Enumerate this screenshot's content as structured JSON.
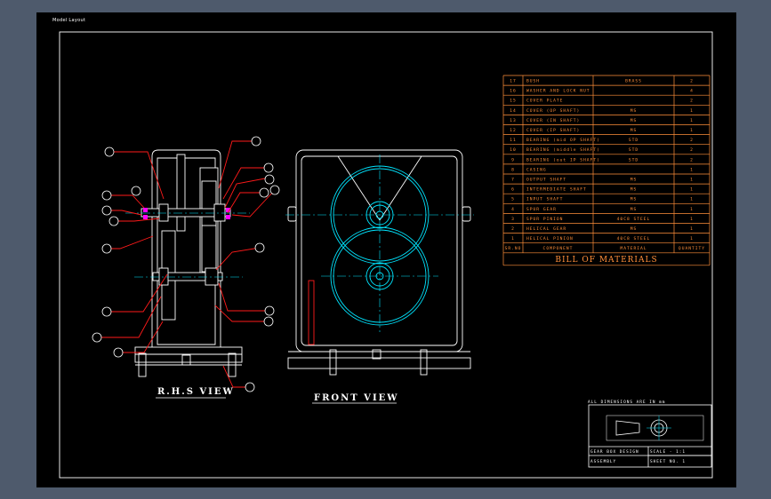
{
  "tab_label": "Model  Layout",
  "views": {
    "side_title": "R.H.S VIEW",
    "front_title": "FRONT VIEW"
  },
  "bom": {
    "title": "BILL OF MATERIALS",
    "header": {
      "no": "SR.NO",
      "name": "COMPONENT",
      "material": "MATERIAL",
      "qty": "QUANTITY"
    },
    "rows": [
      {
        "no": "17",
        "name": "BUSH",
        "material": "BRASS",
        "qty": "2"
      },
      {
        "no": "16",
        "name": "WASHER AND LOCK NUT",
        "material": "",
        "qty": "4"
      },
      {
        "no": "15",
        "name": "COVER PLATE",
        "material": "",
        "qty": "2"
      },
      {
        "no": "14",
        "name": "COVER (OP SHAFT)",
        "material": "MS",
        "qty": "1"
      },
      {
        "no": "13",
        "name": "COVER (IN SHAFT)",
        "material": "MS",
        "qty": "1"
      },
      {
        "no": "12",
        "name": "COVER (IP SHAFT)",
        "material": "MS",
        "qty": "1"
      },
      {
        "no": "11",
        "name": "BEARING (mid OP SHAFT)",
        "material": "STD",
        "qty": "2"
      },
      {
        "no": "10",
        "name": "BEARING (middle SHAFT)",
        "material": "STD",
        "qty": "2"
      },
      {
        "no": "9",
        "name": "BEARING (out IP SHAFT)",
        "material": "STD",
        "qty": "2"
      },
      {
        "no": "8",
        "name": "CASING",
        "material": "",
        "qty": "1"
      },
      {
        "no": "7",
        "name": "OUTPUT SHAFT",
        "material": "MS",
        "qty": "1"
      },
      {
        "no": "6",
        "name": "INTERMEDIATE SHAFT",
        "material": "MS",
        "qty": "1"
      },
      {
        "no": "5",
        "name": "INPUT SHAFT",
        "material": "MS",
        "qty": "1"
      },
      {
        "no": "4",
        "name": "SPUR GEAR",
        "material": "MS",
        "qty": "1"
      },
      {
        "no": "3",
        "name": "SPUR PINION",
        "material": "40C8 STEEL",
        "qty": "1"
      },
      {
        "no": "2",
        "name": "HELICAL GEAR",
        "material": "MS",
        "qty": "1"
      },
      {
        "no": "1",
        "name": "HELICAL PINION",
        "material": "40C8 STEEL",
        "qty": "1"
      }
    ]
  },
  "title_block": {
    "note": "ALL DIMENSIONS ARE IN mm",
    "row1_left": "GEAR BOX DESIGN",
    "row1_right": "SCALE - 1:1",
    "row2_left": "ASSEMBLY",
    "row2_right": "SHEET NO. 1"
  },
  "colors": {
    "background": "#4e5a6c",
    "sheet": "#000000",
    "border": "#ffffff",
    "bom": "#ff8f3a",
    "gear": "#00e5ff",
    "leader": "#ff1a1a",
    "bearing": "#ff00ff",
    "centerline": "#00e5ff"
  }
}
